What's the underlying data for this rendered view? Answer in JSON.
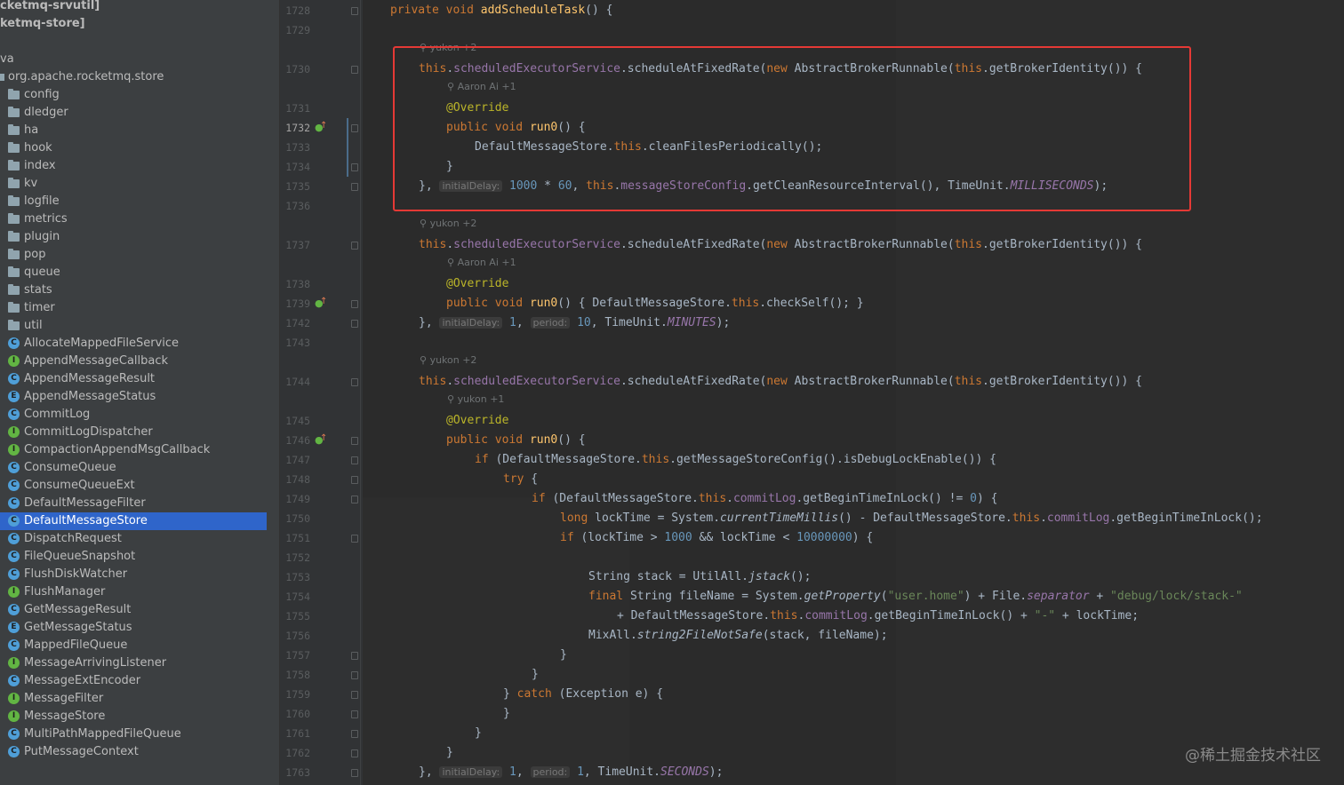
{
  "project_tree": {
    "module_rows": [
      "cketmq-srvutil]",
      "ketmq-store]"
    ],
    "source_root": "va",
    "package": "org.apache.rocketmq.store",
    "folders": [
      "config",
      "dledger",
      "ha",
      "hook",
      "index",
      "kv",
      "logfile",
      "metrics",
      "plugin",
      "pop",
      "queue",
      "stats",
      "timer",
      "util"
    ],
    "classes": [
      {
        "name": "AllocateMappedFileService",
        "kind": "class"
      },
      {
        "name": "AppendMessageCallback",
        "kind": "interface"
      },
      {
        "name": "AppendMessageResult",
        "kind": "class"
      },
      {
        "name": "AppendMessageStatus",
        "kind": "enum"
      },
      {
        "name": "CommitLog",
        "kind": "class"
      },
      {
        "name": "CommitLogDispatcher",
        "kind": "interface"
      },
      {
        "name": "CompactionAppendMsgCallback",
        "kind": "interface"
      },
      {
        "name": "ConsumeQueue",
        "kind": "class"
      },
      {
        "name": "ConsumeQueueExt",
        "kind": "class"
      },
      {
        "name": "DefaultMessageFilter",
        "kind": "class"
      },
      {
        "name": "DefaultMessageStore",
        "kind": "class",
        "selected": true
      },
      {
        "name": "DispatchRequest",
        "kind": "class"
      },
      {
        "name": "FileQueueSnapshot",
        "kind": "class"
      },
      {
        "name": "FlushDiskWatcher",
        "kind": "class"
      },
      {
        "name": "FlushManager",
        "kind": "interface"
      },
      {
        "name": "GetMessageResult",
        "kind": "class"
      },
      {
        "name": "GetMessageStatus",
        "kind": "enum"
      },
      {
        "name": "MappedFileQueue",
        "kind": "class"
      },
      {
        "name": "MessageArrivingListener",
        "kind": "interface"
      },
      {
        "name": "MessageExtEncoder",
        "kind": "class"
      },
      {
        "name": "MessageFilter",
        "kind": "interface"
      },
      {
        "name": "MessageStore",
        "kind": "interface"
      },
      {
        "name": "MultiPathMappedFileQueue",
        "kind": "class"
      },
      {
        "name": "PutMessageContext",
        "kind": "class"
      }
    ]
  },
  "editor": {
    "line_numbers": [
      "1728",
      "1729",
      "1730",
      "1731",
      "1732",
      "1733",
      "1734",
      "1735",
      "1736",
      "1737",
      "1738",
      "1739",
      "1742",
      "1743",
      "1744",
      "1745",
      "1746",
      "1747",
      "1748",
      "1749",
      "1750",
      "1751",
      "1752",
      "1753",
      "1754",
      "1755",
      "1756",
      "1757",
      "1758",
      "1759",
      "1760",
      "1761",
      "1762",
      "1763"
    ],
    "current_line": "1732",
    "blame": [
      {
        "text": "yukon +2"
      },
      {
        "text": "Aaron Ai +1"
      },
      {
        "text": "yukon +2"
      },
      {
        "text": "Aaron Ai +1"
      },
      {
        "text": "yukon +2"
      },
      {
        "text": "yukon +1"
      }
    ],
    "hints": {
      "initialDelay": "initialDelay:",
      "period": "period:"
    },
    "lines": [
      "private void addScheduleTask() {",
      "this.scheduledExecutorService.scheduleAtFixedRate(new AbstractBrokerRunnable(this.getBrokerIdentity()) {",
      "@Override",
      "public void run0() {",
      "DefaultMessageStore.this.cleanFilesPeriodically();",
      "}",
      "}, initialDelay: 1000 * 60, this.messageStoreConfig.getCleanResourceInterval(), TimeUnit.MILLISECONDS);",
      "this.scheduledExecutorService.scheduleAtFixedRate(new AbstractBrokerRunnable(this.getBrokerIdentity()) {",
      "@Override",
      "public void run0() { DefaultMessageStore.this.checkSelf(); }",
      "}, initialDelay: 1, period: 10, TimeUnit.MINUTES);",
      "this.scheduledExecutorService.scheduleAtFixedRate(new AbstractBrokerRunnable(this.getBrokerIdentity()) {",
      "@Override",
      "public void run0() {",
      "if (DefaultMessageStore.this.getMessageStoreConfig().isDebugLockEnable()) {",
      "try {",
      "if (DefaultMessageStore.this.commitLog.getBeginTimeInLock() != 0) {",
      "long lockTime = System.currentTimeMillis() - DefaultMessageStore.this.commitLog.getBeginTimeInLock();",
      "if (lockTime > 1000 && lockTime < 10000000) {",
      "String stack = UtilAll.jstack();",
      "final String fileName = System.getProperty(\"user.home\") + File.separator + \"debug/lock/stack-\"",
      "+ DefaultMessageStore.this.commitLog.getBeginTimeInLock() + \"-\" + lockTime;",
      "MixAll.string2FileNotSafe(stack, fileName);",
      "}",
      "}",
      "} catch (Exception e) {",
      "}",
      "}",
      "}",
      "}, initialDelay: 1, period: 1, TimeUnit.SECONDS);"
    ]
  },
  "watermark": "@稀土掘金技术社区",
  "colors": {
    "highlight_box": "#e53935",
    "selection": "#2f65ca",
    "keyword": "#cc7832",
    "method": "#ffc66d",
    "field": "#9876aa",
    "number": "#6897bb",
    "string": "#6a8759",
    "annotation": "#bbb529"
  }
}
